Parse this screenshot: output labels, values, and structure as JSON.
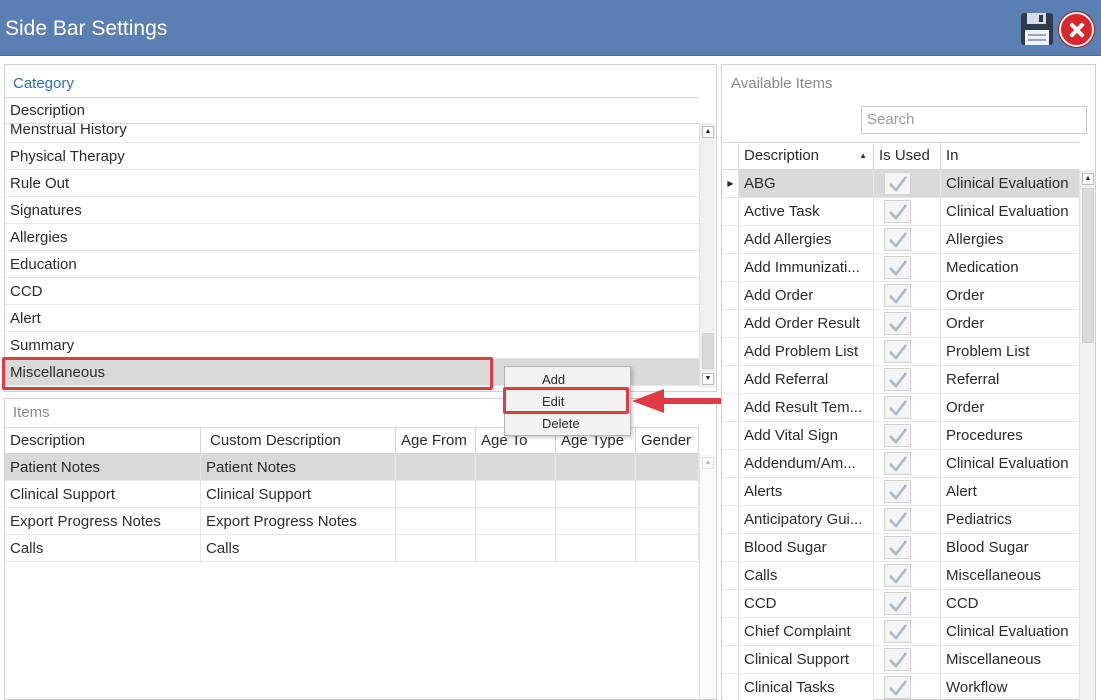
{
  "window": {
    "title": "Side Bar Settings",
    "save_icon": "save-icon",
    "close_icon": "close-icon"
  },
  "category": {
    "title": "Category",
    "header": "Description",
    "items": [
      "Menstrual History",
      "Physical Therapy",
      "Rule Out",
      "Signatures",
      "Allergies",
      "Education",
      "CCD",
      "Alert",
      "Summary",
      "Miscellaneous"
    ],
    "selected": "Miscellaneous"
  },
  "context_menu": {
    "items": [
      "Add",
      "Edit",
      "Delete"
    ],
    "highlighted": "Edit"
  },
  "items_panel": {
    "title": "Items",
    "columns": [
      "Description",
      "Custom Description",
      "Age From",
      "Age To",
      "Age Type",
      "Gender"
    ],
    "rows": [
      [
        "Patient Notes",
        "Patient Notes",
        "",
        "",
        "",
        ""
      ],
      [
        "Clinical Support",
        "Clinical Support",
        "",
        "",
        "",
        ""
      ],
      [
        "Export Progress Notes",
        "Export Progress Notes",
        "",
        "",
        "",
        ""
      ],
      [
        "Calls",
        "Calls",
        "",
        "",
        "",
        ""
      ]
    ]
  },
  "available": {
    "title": "Available Items",
    "search_placeholder": "Search",
    "columns": [
      "Description",
      "Is Used",
      "In"
    ],
    "rows": [
      [
        "ABG",
        true,
        "Clinical Evaluation"
      ],
      [
        "Active Task",
        true,
        "Clinical Evaluation"
      ],
      [
        "Add Allergies",
        true,
        "Allergies"
      ],
      [
        "Add Immunizati...",
        true,
        "Medication"
      ],
      [
        "Add Order",
        true,
        "Order"
      ],
      [
        "Add Order Result",
        true,
        "Order"
      ],
      [
        "Add Problem List",
        true,
        "Problem List"
      ],
      [
        "Add Referral",
        true,
        "Referral"
      ],
      [
        "Add Result Tem...",
        true,
        "Order"
      ],
      [
        "Add Vital Sign",
        true,
        "Procedures"
      ],
      [
        "Addendum/Am...",
        true,
        "Clinical Evaluation"
      ],
      [
        "Alerts",
        true,
        "Alert"
      ],
      [
        "Anticipatory Gui...",
        true,
        "Pediatrics"
      ],
      [
        "Blood Sugar",
        true,
        "Blood Sugar"
      ],
      [
        "Calls",
        true,
        "Miscellaneous"
      ],
      [
        "CCD",
        true,
        "CCD"
      ],
      [
        "Chief Complaint",
        true,
        "Clinical Evaluation"
      ],
      [
        "Clinical Support",
        true,
        "Miscellaneous"
      ],
      [
        "Clinical Tasks",
        true,
        "Workflow"
      ]
    ]
  },
  "colors": {
    "titlebar": "#5a80b3",
    "accent_link": "#2f6db3",
    "highlight": "#e03a45",
    "selected_row": "#d9d9d9"
  }
}
